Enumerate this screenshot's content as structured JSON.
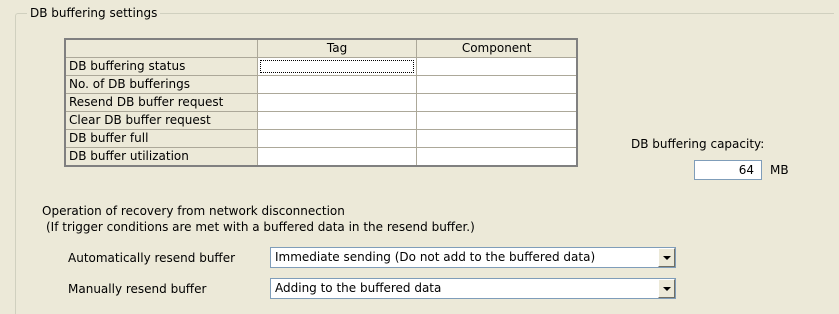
{
  "group": {
    "title": "DB buffering settings"
  },
  "table": {
    "headers": [
      "",
      "Tag",
      "Component"
    ],
    "rows": [
      {
        "label": "DB buffering status",
        "tag": "",
        "component": ""
      },
      {
        "label": "No. of DB bufferings",
        "tag": "",
        "component": ""
      },
      {
        "label": "Resend DB buffer request",
        "tag": "",
        "component": ""
      },
      {
        "label": "Clear DB buffer request",
        "tag": "",
        "component": ""
      },
      {
        "label": "DB buffer full",
        "tag": "",
        "component": ""
      },
      {
        "label": "DB buffer utilization",
        "tag": "",
        "component": ""
      }
    ]
  },
  "capacity": {
    "label": "DB buffering capacity:",
    "value": "64",
    "unit": "MB"
  },
  "recovery": {
    "line1": "Operation of recovery from network disconnection",
    "line2": "(If trigger conditions are met with a buffered data in the resend buffer.)",
    "auto": {
      "label": "Automatically resend buffer",
      "value": "Immediate sending (Do not add to the buffered data)"
    },
    "manual": {
      "label": "Manually resend buffer",
      "value": "Adding to the buffered data"
    }
  },
  "icons": {
    "dropdown": "chevron-down-icon"
  }
}
